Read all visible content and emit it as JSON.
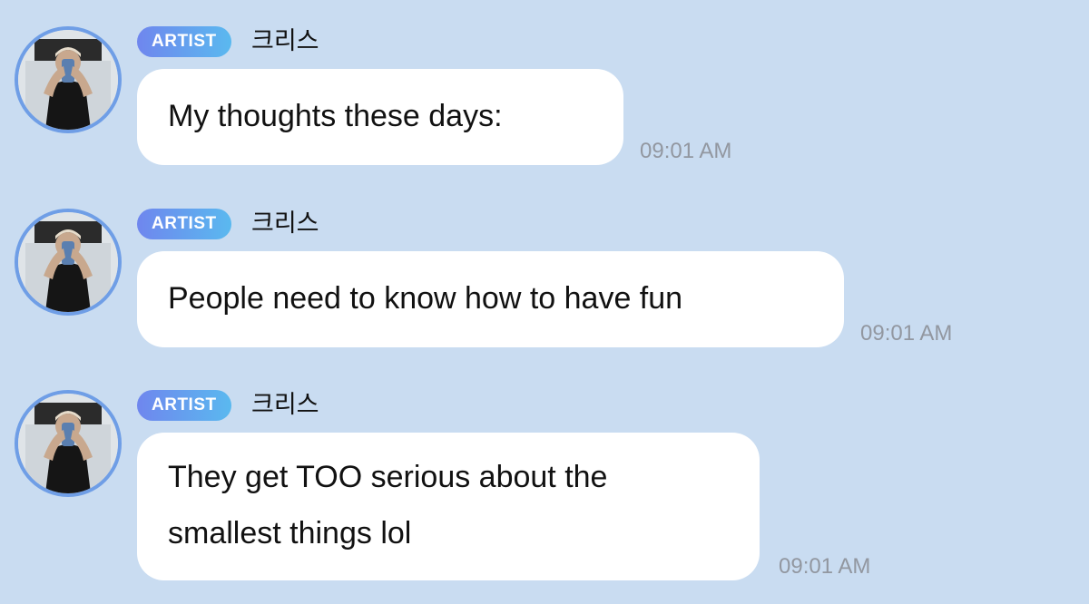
{
  "messages": [
    {
      "badge": "ARTIST",
      "sender": "크리스",
      "text": "My thoughts these days:",
      "time": "09:01 AM"
    },
    {
      "badge": "ARTIST",
      "sender": "크리스",
      "text": "People need to know how to have fun",
      "time": "09:01 AM"
    },
    {
      "badge": "ARTIST",
      "sender": "크리스",
      "text": "They get TOO serious about the\nsmallest things lol",
      "time": "09:01 AM"
    }
  ],
  "colors": {
    "background": "#c9dcf1",
    "badge_gradient_start": "#6f86ee",
    "badge_gradient_end": "#5ab9ef",
    "avatar_ring": "#6f9ee6",
    "bubble": "#ffffff",
    "timestamp": "#9297a0"
  },
  "icons": {
    "avatar": "profile-photo-avatar"
  }
}
